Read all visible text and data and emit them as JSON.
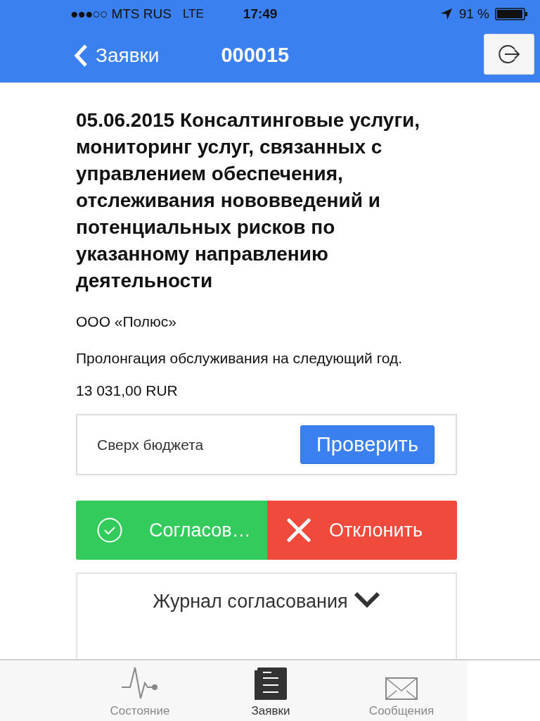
{
  "status_bar": {
    "signal": "●●●○○",
    "carrier": "MTS RUS",
    "network": "LTE",
    "time": "17:49",
    "battery": "91 %"
  },
  "nav_bar": {
    "back": "Заявки",
    "title": "000015"
  },
  "request": {
    "title": "05.06.2015 Консалтинговые услуги, мониторинг услуг, связанных с управлением обеспечения, отслеживания нововведений и потенциальных рисков по указанному направлению деятельности",
    "company": "ООО «Полюс»",
    "description": "Пролонгация обслуживания на следующий год.",
    "amount": "13 031,00  RUR"
  },
  "budget": {
    "label": "Сверх бюджета",
    "button": "Проверить"
  },
  "actions": [
    {
      "kind": "approve",
      "label": "Согласов…"
    },
    {
      "kind": "reject",
      "label": "Отклонить"
    }
  ],
  "journal": {
    "label": "Журнал согласования",
    "expanded": false
  },
  "tabs": [
    {
      "kind": "status",
      "label": "Состояние",
      "selected": false
    },
    {
      "kind": "requests",
      "label": "Заявки",
      "selected": true
    },
    {
      "kind": "messages",
      "label": "Сообщения",
      "selected": false
    }
  ]
}
